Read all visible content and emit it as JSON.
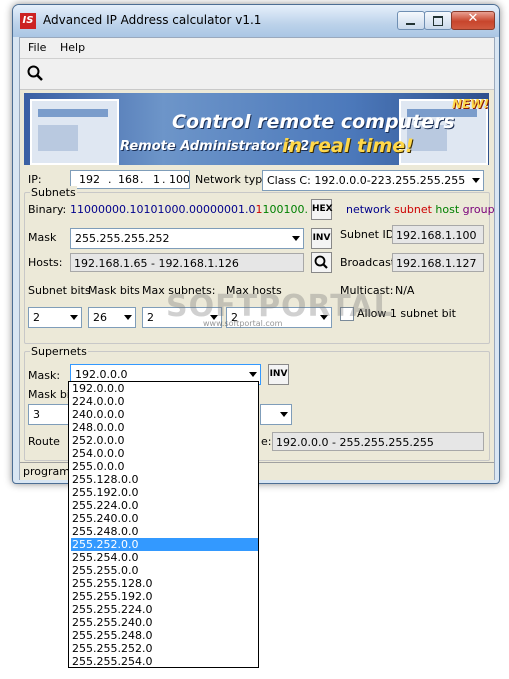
{
  "window": {
    "title": "Advanced IP Address calculator v1.1",
    "icon_text": "IS"
  },
  "menu": {
    "file": "File",
    "help": "Help"
  },
  "banner": {
    "headline": "Control remote computers",
    "sub1": "Remote Administrator 2.2",
    "sub2": "in real time!",
    "new_badge": "NEW!"
  },
  "ip": {
    "label": "IP:",
    "octets": [
      "192",
      "168",
      "1",
      "100"
    ],
    "network_type_label": "Network type:",
    "network_type_value": "Class C: 192.0.0.0-223.255.255.255"
  },
  "subnets": {
    "group_label": "Subnets",
    "binary_label": "Binary:",
    "binary_network": "11000000.10101000.00000001.0",
    "binary_subnet": "1",
    "binary_host": "100100.",
    "hex_button": "HEX",
    "legend": {
      "network": "network",
      "subnet": "subnet",
      "host": "host",
      "group": "group"
    },
    "mask_label": "Mask",
    "mask_value": "255.255.255.252",
    "inv_button": "INV",
    "subnet_id_label": "Subnet ID:",
    "subnet_id_value": "192.168.1.100",
    "hosts_label": "Hosts:",
    "hosts_value": "192.168.1.65 - 192.168.1.126",
    "broadcast_label": "Broadcast:",
    "broadcast_value": "192.168.1.127",
    "subnet_bits_label": "Subnet bits",
    "mask_bits_label": "Mask bits",
    "max_subnets_label": "Max subnets:",
    "max_hosts_label": "Max hosts",
    "multicast_label": "Multicast:",
    "multicast_value": "N/A",
    "subnet_bits_value": "2",
    "mask_bits_value": "26",
    "max_subnets_value": "2",
    "max_hosts_value": "2",
    "allow_subnet_label": "Allow 1 subnet bit"
  },
  "supernets": {
    "group_label": "Supernets",
    "mask_label": "Mask:",
    "mask_value": "192.0.0.0",
    "inv_button": "INV",
    "mask_bits_label": "Mask bits",
    "mask_bits_value": "3",
    "route_label": "Route",
    "range_label": "e:",
    "range_value": "192.0.0.0 - 255.255.255.255"
  },
  "status": {
    "text": "program i"
  },
  "dropdown": {
    "selected_index": 12,
    "options": [
      "192.0.0.0",
      "224.0.0.0",
      "240.0.0.0",
      "248.0.0.0",
      "252.0.0.0",
      "254.0.0.0",
      "255.0.0.0",
      "255.128.0.0",
      "255.192.0.0",
      "255.224.0.0",
      "255.240.0.0",
      "255.248.0.0",
      "255.252.0.0",
      "255.254.0.0",
      "255.255.0.0",
      "255.255.128.0",
      "255.255.192.0",
      "255.255.224.0",
      "255.255.240.0",
      "255.255.248.0",
      "255.255.252.0",
      "255.255.254.0"
    ]
  },
  "watermark": {
    "main": "SOFTPORTAL",
    "sub": "www.softportal.com"
  },
  "colors": {
    "network": "#00008b",
    "subnet": "#cc0000",
    "host": "#008000",
    "group": "#7a007a",
    "selection": "#3399ff"
  }
}
